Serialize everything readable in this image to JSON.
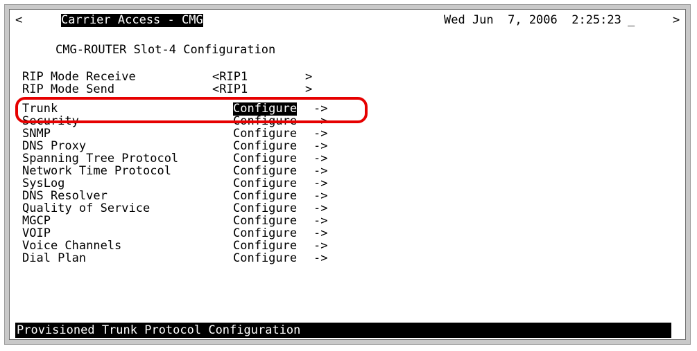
{
  "header": {
    "scroll_left": "<",
    "title": "Carrier Access - CMG",
    "datetime": "Wed Jun  7, 2006  2:25:23",
    "cursor": "_",
    "scroll_right": ">"
  },
  "page_title": "CMG-ROUTER Slot-4 Configuration",
  "settings": [
    {
      "label": "RIP Mode Receive",
      "value": "<RIP1",
      "end": ">"
    },
    {
      "label": "RIP Mode Send",
      "value": "<RIP1",
      "end": ">"
    }
  ],
  "menu": [
    {
      "label": "Trunk",
      "action": "Configure",
      "arrow": "->"
    },
    {
      "label": "Security",
      "action": "Configure",
      "arrow": "->"
    },
    {
      "label": "SNMP",
      "action": "Configure",
      "arrow": "->"
    },
    {
      "label": "DNS Proxy",
      "action": "Configure",
      "arrow": "->"
    },
    {
      "label": "Spanning Tree Protocol",
      "action": "Configure",
      "arrow": "->"
    },
    {
      "label": "Network Time Protocol",
      "action": "Configure",
      "arrow": "->"
    },
    {
      "label": "SysLog",
      "action": "Configure",
      "arrow": "->"
    },
    {
      "label": "DNS Resolver",
      "action": "Configure",
      "arrow": "->"
    },
    {
      "label": "Quality of Service",
      "action": "Configure",
      "arrow": "->"
    },
    {
      "label": "MGCP",
      "action": "Configure",
      "arrow": "->"
    },
    {
      "label": "VOIP",
      "action": "Configure",
      "arrow": "->"
    },
    {
      "label": "Voice Channels",
      "action": "Configure",
      "arrow": "->"
    },
    {
      "label": "Dial Plan",
      "action": "Configure",
      "arrow": "->"
    }
  ],
  "status_bar": "Provisioned Trunk Protocol Configuration",
  "colors": {
    "highlight": "#e60000",
    "selected_bg": "#000000",
    "selected_fg": "#ffffff"
  }
}
